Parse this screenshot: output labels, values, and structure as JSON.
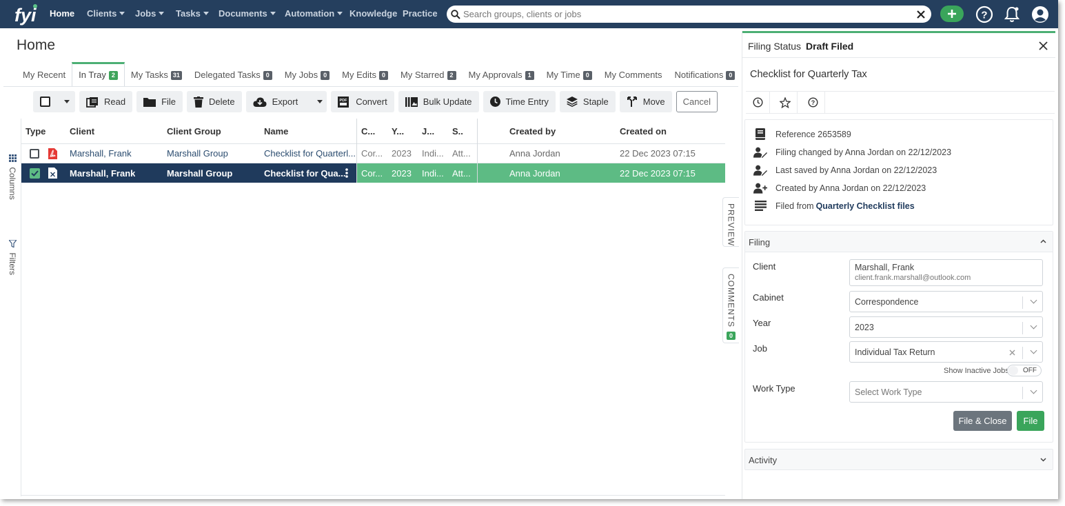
{
  "nav": {
    "items": [
      "Home",
      "Clients",
      "Jobs",
      "Tasks",
      "Documents",
      "Automation",
      "Knowledge",
      "Practice"
    ],
    "search_placeholder": "Search groups, clients or jobs"
  },
  "page": {
    "title": "Home",
    "tabs": [
      {
        "label": "My Recent",
        "badge": ""
      },
      {
        "label": "In Tray",
        "badge": "2"
      },
      {
        "label": "My Tasks",
        "badge": "31"
      },
      {
        "label": "Delegated Tasks",
        "badge": "0"
      },
      {
        "label": "My Jobs",
        "badge": "0"
      },
      {
        "label": "My Edits",
        "badge": "0"
      },
      {
        "label": "My Starred",
        "badge": "2"
      },
      {
        "label": "My Approvals",
        "badge": "1"
      },
      {
        "label": "My Time",
        "badge": "0"
      },
      {
        "label": "My Comments",
        "badge": ""
      },
      {
        "label": "Notifications",
        "badge": "0"
      }
    ]
  },
  "toolbar": {
    "read": "Read",
    "file": "File",
    "delete": "Delete",
    "export": "Export",
    "convert": "Convert",
    "bulk_update": "Bulk Update",
    "time_entry": "Time Entry",
    "staple": "Staple",
    "move": "Move",
    "cancel": "Cancel"
  },
  "side": {
    "columns": "Columns",
    "filters": "Filters",
    "preview": "PREVIEW",
    "comments": "COMMENTS",
    "comments_count": "0"
  },
  "grid": {
    "headers": [
      "Type",
      "Client",
      "Client Group",
      "Name",
      "C...",
      "Y...",
      "J...",
      "S..",
      "Created by",
      "Created on"
    ],
    "rows": [
      {
        "type": "pdf-icon",
        "client": "Marshall, Frank",
        "group": "Marshall Group",
        "name": "Checklist for Quarterl...",
        "c": "Cor...",
        "y": "2023",
        "j": "Indi...",
        "s": "Att...",
        "created_by": "Anna Jordan",
        "created_on": "22 Dec 2023 07:15",
        "selected": false
      },
      {
        "type": "excel-icon",
        "client": "Marshall, Frank",
        "group": "Marshall Group",
        "name": "Checklist for Qua...",
        "c": "Cor...",
        "y": "2023",
        "j": "Indi...",
        "s": "Att...",
        "created_by": "Anna Jordan",
        "created_on": "22 Dec 2023 07:15",
        "selected": true
      }
    ]
  },
  "panel": {
    "status_label": "Filing Status",
    "status_value": "Draft Filed",
    "doc_title": "Checklist for Quarterly Tax",
    "reference": "Reference 2653589",
    "filing_changed": "Filing changed by Anna Jordan on 22/12/2023",
    "last_saved": "Last saved by Anna Jordan on 22/12/2023",
    "created_by": "Created by Anna Jordan on 22/12/2023",
    "filed_from_prefix": "Filed from ",
    "filed_from_value": "Quarterly Checklist files",
    "filing_section": "Filing",
    "client_label": "Client",
    "client_name": "Marshall, Frank",
    "client_email": "client.frank.marshall@outlook.com",
    "cabinet_label": "Cabinet",
    "cabinet_value": "Correspondence",
    "year_label": "Year",
    "year_value": "2023",
    "job_label": "Job",
    "job_value": "Individual Tax Return",
    "show_inactive": "Show Inactive Jobs",
    "toggle_state": "OFF",
    "work_type_label": "Work Type",
    "work_type_placeholder": "Select Work Type",
    "file_close_button": "File & Close",
    "file_button": "File",
    "activity_section": "Activity"
  },
  "colors": {
    "nav_bg": "#253f5e",
    "accent_green": "#4caf74",
    "selected_row_dark": "#1f3a5c",
    "selected_row_green": "#5dbb84",
    "file_close_grey": "#6c757d",
    "file_green": "#3aa55b"
  }
}
